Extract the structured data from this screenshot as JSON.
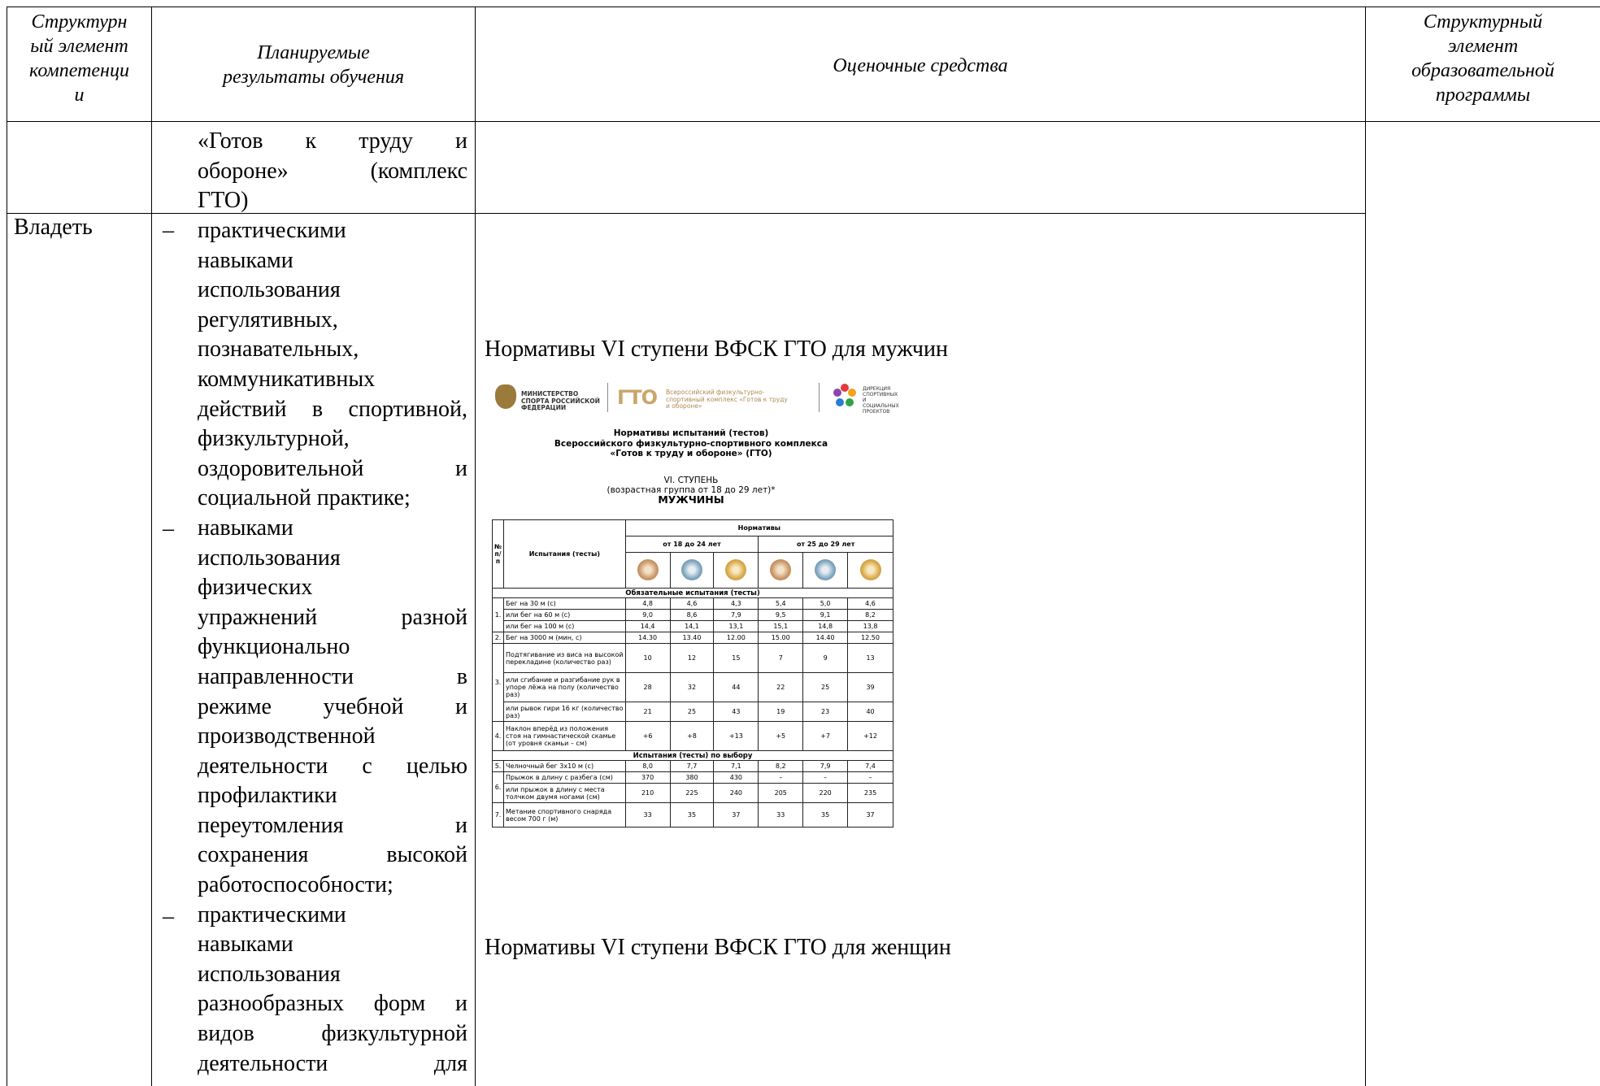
{
  "header": {
    "col1": "Структурный элемент компетенции",
    "col1_lines": [
      "Структурн",
      "ый элемент",
      "компетенци",
      "и"
    ],
    "col2_lines": [
      "Планируемые",
      "результаты обучения"
    ],
    "col3": "Оценочные средства",
    "col4_lines": [
      "Структурный",
      "элемент",
      "образовательной",
      "программы"
    ]
  },
  "row1": {
    "results_lines": [
      "«Готов к труду и",
      "обороне» (комплекс",
      "ГТО)"
    ]
  },
  "row2": {
    "element": "Владеть",
    "dash": "–",
    "results_lines": [
      "практическими",
      "навыками",
      "использования",
      "регулятивных,",
      "познавательных,",
      "коммуникативных",
      "действий в спортивной,",
      "физкультурной,",
      "оздоровительной и",
      "социальной практике;",
      "навыками",
      "использования",
      "физических",
      "упражнений разной",
      "функционально",
      "направленности в",
      "режиме учебной и",
      "производственной",
      "деятельности с целью",
      "профилактики",
      "переутомления и",
      "сохранения высокой",
      "работоспособности;",
      "практическими",
      "навыками",
      "использования",
      "разнообразных форм и",
      "видов физкультурной",
      "деятельности для"
    ],
    "caption_men": "Нормативы VI ступени ВФСК ГТО для мужчин",
    "caption_women": "Нормативы VI ступени ВФСК ГТО для женщин"
  },
  "image": {
    "logo1": "МИНИСТЕРСТВО СПОРТА РОССИЙСКОЙ ФЕДЕРАЦИИ",
    "logo2_mark": "ГТО",
    "logo2": "Всероссийский физкультурно-спортивный комплекс «Готов к труду и обороне»",
    "logo3": "ДИРЕКЦИЯ СПОРТИВНЫХ И СОЦИАЛЬНЫХ ПРОЕКТОВ",
    "title_lines": [
      "Нормативы испытаний (тестов)",
      "Всероссийского физкультурно-спортивного комплекса",
      "«Готов к труду и обороне» (ГТО)"
    ],
    "stage": "VI. СТУПЕНЬ",
    "age_group": "(возрастная группа от 18 до 29 лет)*",
    "gender": "МУЖЧИНЫ",
    "th_num": "№ п/п",
    "th_tests": "Испытания (тесты)",
    "th_norms": "Нормативы",
    "th_age1": "от 18 до 24 лет",
    "th_age2": "от 25 до 29 лет",
    "section_mandatory": "Обязательные испытания (тесты)",
    "section_optional": "Испытания (тесты) по выбору",
    "rows": [
      {
        "n": "1.",
        "test": "Бег на 30 м (с)",
        "v": [
          "4,8",
          "4,6",
          "4,3",
          "5,4",
          "5,0",
          "4,6"
        ]
      },
      {
        "n": "",
        "test": "или бег на 60 м (с)",
        "v": [
          "9,0",
          "8,6",
          "7,9",
          "9,5",
          "9,1",
          "8,2"
        ]
      },
      {
        "n": "",
        "test": "или бег на 100 м (с)",
        "v": [
          "14,4",
          "14,1",
          "13,1",
          "15,1",
          "14,8",
          "13,8"
        ]
      },
      {
        "n": "2.",
        "test": "Бег на 3000 м (мин, с)",
        "v": [
          "14.30",
          "13.40",
          "12.00",
          "15.00",
          "14.40",
          "12.50"
        ]
      },
      {
        "n": "3.",
        "test": "Подтягивание из виса на высокой перекладине (количество раз)",
        "v": [
          "10",
          "12",
          "15",
          "7",
          "9",
          "13"
        ]
      },
      {
        "n": "",
        "test": "или сгибание и разгибание рук в упоре лёжа на полу (количество раз)",
        "v": [
          "28",
          "32",
          "44",
          "22",
          "25",
          "39"
        ]
      },
      {
        "n": "",
        "test": "или рывок гири 16 кг (количество раз)",
        "v": [
          "21",
          "25",
          "43",
          "19",
          "23",
          "40"
        ]
      },
      {
        "n": "4.",
        "test": "Наклон вперёд из положения стоя на гимнастической скамье (от уровня скамьи – см)",
        "v": [
          "+6",
          "+8",
          "+13",
          "+5",
          "+7",
          "+12"
        ]
      },
      {
        "n": "5.",
        "test": "Челночный бег 3х10 м (с)",
        "v": [
          "8,0",
          "7,7",
          "7,1",
          "8,2",
          "7,9",
          "7,4"
        ]
      },
      {
        "n": "6.",
        "test": "Прыжок в длину с разбега (см)",
        "v": [
          "370",
          "380",
          "430",
          "–",
          "–",
          "–"
        ]
      },
      {
        "n": "",
        "test": "или прыжок в длину с места толчком двумя ногами (см)",
        "v": [
          "210",
          "225",
          "240",
          "205",
          "220",
          "235"
        ]
      },
      {
        "n": "7.",
        "test": "Метание спортивного снаряда весом 700 г (м)",
        "v": [
          "33",
          "35",
          "37",
          "33",
          "35",
          "37"
        ]
      }
    ]
  }
}
